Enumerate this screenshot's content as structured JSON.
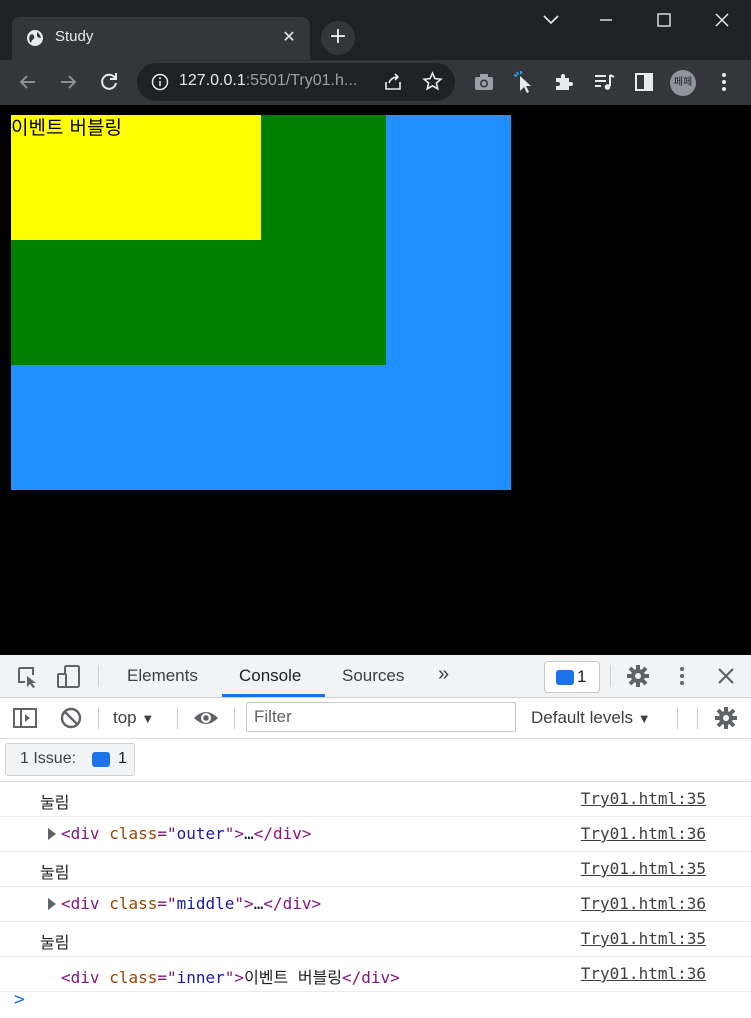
{
  "browser": {
    "tab_title": "Study",
    "tab_close": "✕",
    "new_tab": "+",
    "url_host": "127.0.0.1",
    "url_rest": ":5501/Try01.h...",
    "profile_label": "페페"
  },
  "page": {
    "inner_text": "이벤트 버블링",
    "colors": {
      "outer": "#1e90ff",
      "middle": "#008000",
      "inner": "#ffff00",
      "background": "#000000"
    }
  },
  "devtools": {
    "tabs": [
      "Elements",
      "Console",
      "Sources"
    ],
    "more_tabs": "»",
    "issue_count": "1",
    "context": "top",
    "filter_placeholder": "Filter",
    "levels": "Default levels",
    "issues_label": "1 Issue:",
    "issues_count": "1",
    "console_lines": [
      {
        "kind": "text",
        "message": "눌림",
        "source": "Try01.html:35"
      },
      {
        "kind": "element",
        "collapsed": true,
        "tag": "div",
        "attr": "class",
        "value": "outer",
        "content": "…",
        "source": "Try01.html:36"
      },
      {
        "kind": "text",
        "message": "눌림",
        "source": "Try01.html:35"
      },
      {
        "kind": "element",
        "collapsed": true,
        "tag": "div",
        "attr": "class",
        "value": "middle",
        "content": "…",
        "source": "Try01.html:36"
      },
      {
        "kind": "text",
        "message": "눌림",
        "source": "Try01.html:35"
      },
      {
        "kind": "element",
        "collapsed": false,
        "tag": "div",
        "attr": "class",
        "value": "inner",
        "content": "이벤트 버블링",
        "source": "Try01.html:36"
      }
    ],
    "prompt_symbol": ">"
  }
}
